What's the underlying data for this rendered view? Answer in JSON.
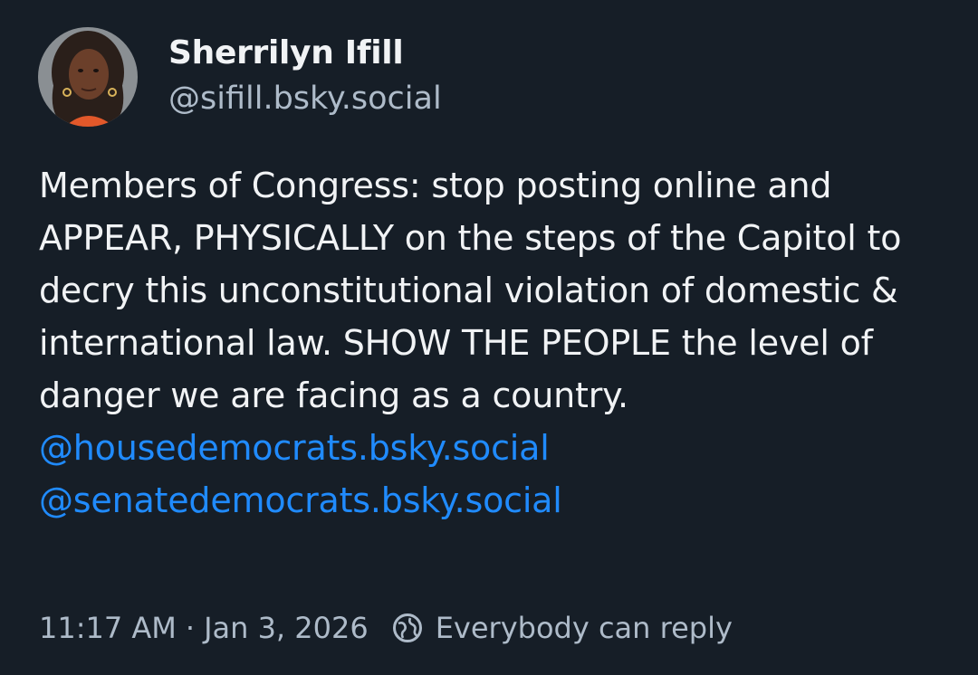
{
  "author": {
    "display_name": "Sherrilyn Ifill",
    "handle": "@sifill.bsky.social",
    "avatar_icon": "profile-photo"
  },
  "post": {
    "text": "Members of Congress: stop posting online and APPEAR, PHYSICALLY on the steps of the Capitol to decry this unconstitutional violation of domestic &  international law. SHOW THE PEOPLE the level of danger we are facing as a country.",
    "mentions": [
      "@housedemocrats.bsky.social",
      "@senatedemocrats.bsky.social"
    ]
  },
  "meta": {
    "time": "11:17 AM",
    "separator": "·",
    "date": "Jan 3, 2026",
    "reply_setting": "Everybody can reply",
    "reply_icon": "globe-icon"
  },
  "colors": {
    "background": "#161e27",
    "text": "#f1f3f5",
    "muted": "#aebbc9",
    "link": "#208bfe"
  }
}
